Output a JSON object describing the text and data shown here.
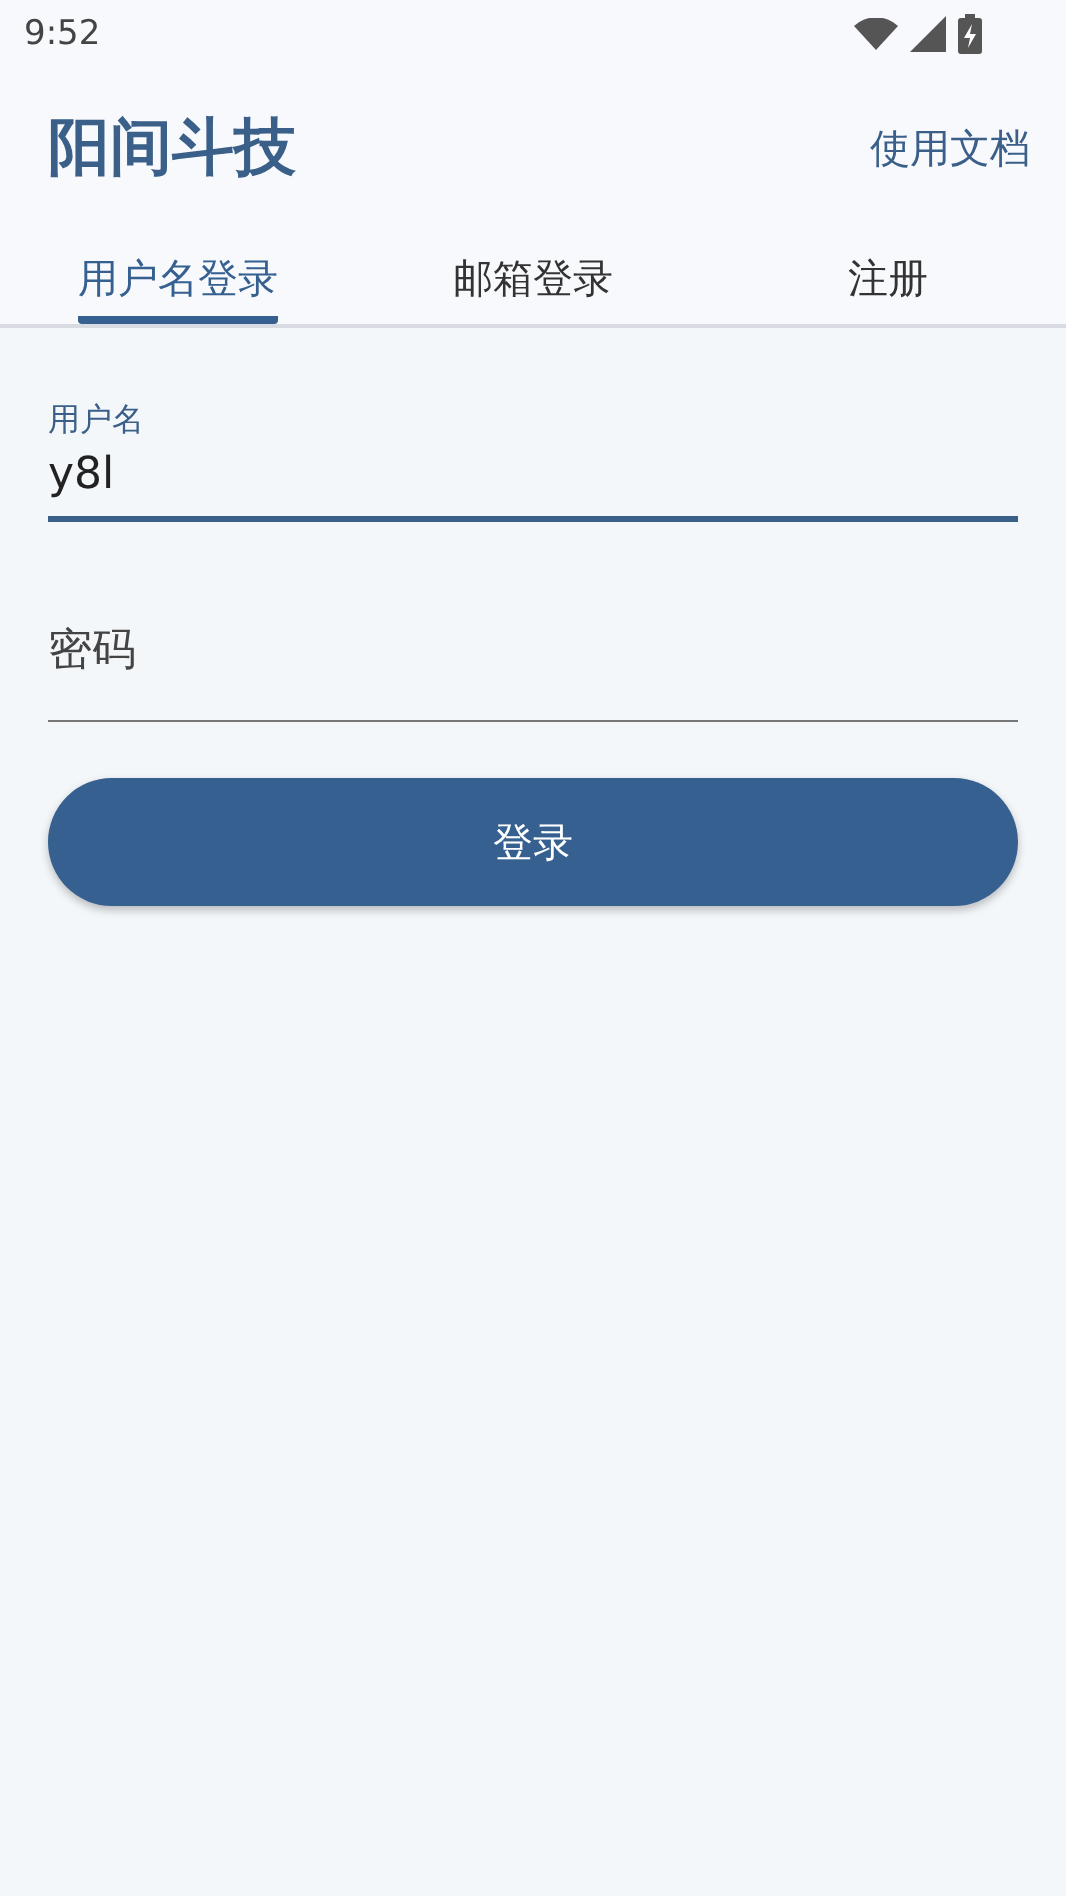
{
  "status_bar": {
    "time": "9:52"
  },
  "header": {
    "title": "阳间斗技",
    "link": "使用文档"
  },
  "tabs": [
    {
      "label": "用户名登录",
      "selected": true
    },
    {
      "label": "邮箱登录",
      "selected": false
    },
    {
      "label": "注册",
      "selected": false
    }
  ],
  "fields": [
    {
      "kind": "text",
      "label": "用户名",
      "value": "y8l",
      "focused": true
    },
    {
      "kind": "password",
      "placeholder": "密码",
      "focused": false
    }
  ],
  "button": "登录"
}
